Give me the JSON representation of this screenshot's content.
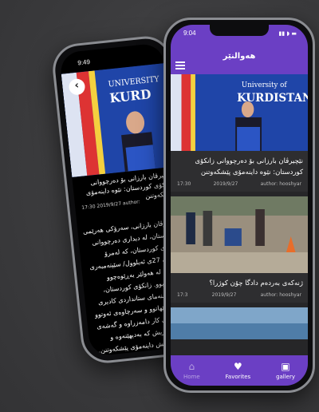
{
  "back_phone": {
    "time": "9:49",
    "back_glyph": "‹",
    "headline": "نێچیرڤان بارزانی بۆ دەرچووانی زانکۆی کوردستان: نێوە داینەمۆی پێشکەوتنن",
    "meta_time": "17:30",
    "meta_date": "2019/9/27",
    "meta_author": "author:",
    "body": "نێچیرڤان بارزانی، سەرۆکی هەرێمی کوردستان، لە دیداری دەرچووانی زانکۆی کوردستان، کە لەمرۆ هەینی، 27ی ئەیلوول/ سێپتەمبەری 2019، لە هەولێر بەڕێوەچوو بەشداربوو. زانکۆی کوردستان، لەسەر بنەمای ستانداردی کادیری کلیل و ئێهاتوو و سەرچاوەی ئەوتوو بۆ بازاڕی کار دامەزراوە و گەشەی بە داهێنەریش کە بەدیهێنەوە و دەرچووانیش داینەمۆی پێشکەوتنن. نێچیرڤان بارزانی ڕوونیشی کردەوە، بە پێی بەرنامەکان 99%ی دەرچووان لە بواری کارەکانی ئەوزە، نەوت و گاز، دیپلۆماسی.",
    "like_glyph": "♥"
  },
  "front_phone": {
    "time": "9:04",
    "signal": "▮▮ ◗ ▬",
    "app_title": "هەوالنێر",
    "cards": [
      {
        "headline": "نێچیرڤان بارزانی بۆ دەرچووانی زانکۆی کوردستان: نێوە داینەمۆی پێشکەوتنن",
        "time": "17:30",
        "date": "2019/9/27",
        "author": "author: hooshyar"
      },
      {
        "headline": "ژنەکەی بەردەم دادگا چۆن کوژرا؟",
        "time": "17:3",
        "date": "2019/9/27",
        "author": "author: hooshyar"
      }
    ],
    "nav": {
      "home": "Home",
      "favorites": "Favorites",
      "gallery": "gallery"
    }
  }
}
